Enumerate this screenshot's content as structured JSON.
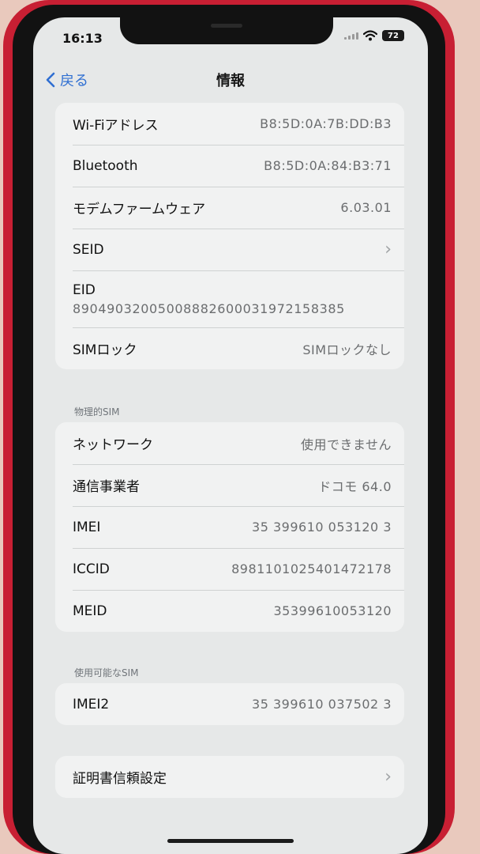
{
  "status_bar": {
    "time": "16:13",
    "battery": "72"
  },
  "nav": {
    "back_label": "戻る",
    "title": "情報"
  },
  "group1": [
    {
      "label": "Wi-Fiアドレス",
      "value": "B8:5D:0A:7B:DD:B3"
    },
    {
      "label": "Bluetooth",
      "value": "B8:5D:0A:84:B3:71"
    },
    {
      "label": "モデムファームウェア",
      "value": "6.03.01"
    },
    {
      "label": "SEID",
      "value": ""
    },
    {
      "label": "EID",
      "value": "89049032005008882600031972158385"
    },
    {
      "label": "SIMロック",
      "value": "SIMロックなし"
    }
  ],
  "section_physical_sim": "物理的SIM",
  "group2": [
    {
      "label": "ネットワーク",
      "value": "使用できません"
    },
    {
      "label": "通信事業者",
      "value": "ドコモ 64.0"
    },
    {
      "label": "IMEI",
      "value": "35 399610 053120 3"
    },
    {
      "label": "ICCID",
      "value": "8981101025401472178"
    },
    {
      "label": "MEID",
      "value": "35399610053120"
    }
  ],
  "section_available_sim": "使用可能なSIM",
  "group3": [
    {
      "label": "IMEI2",
      "value": "35 399610 037502 3"
    }
  ],
  "group4": [
    {
      "label": "証明書信頼設定"
    }
  ],
  "icons": {
    "back": "chevron-left-icon",
    "disclosure": "chevron-right-icon",
    "wifi": "wifi-icon",
    "signal": "signal-icon",
    "battery": "battery-icon"
  },
  "colors": {
    "accent": "#2f6fd2",
    "case": "#c81f33"
  }
}
